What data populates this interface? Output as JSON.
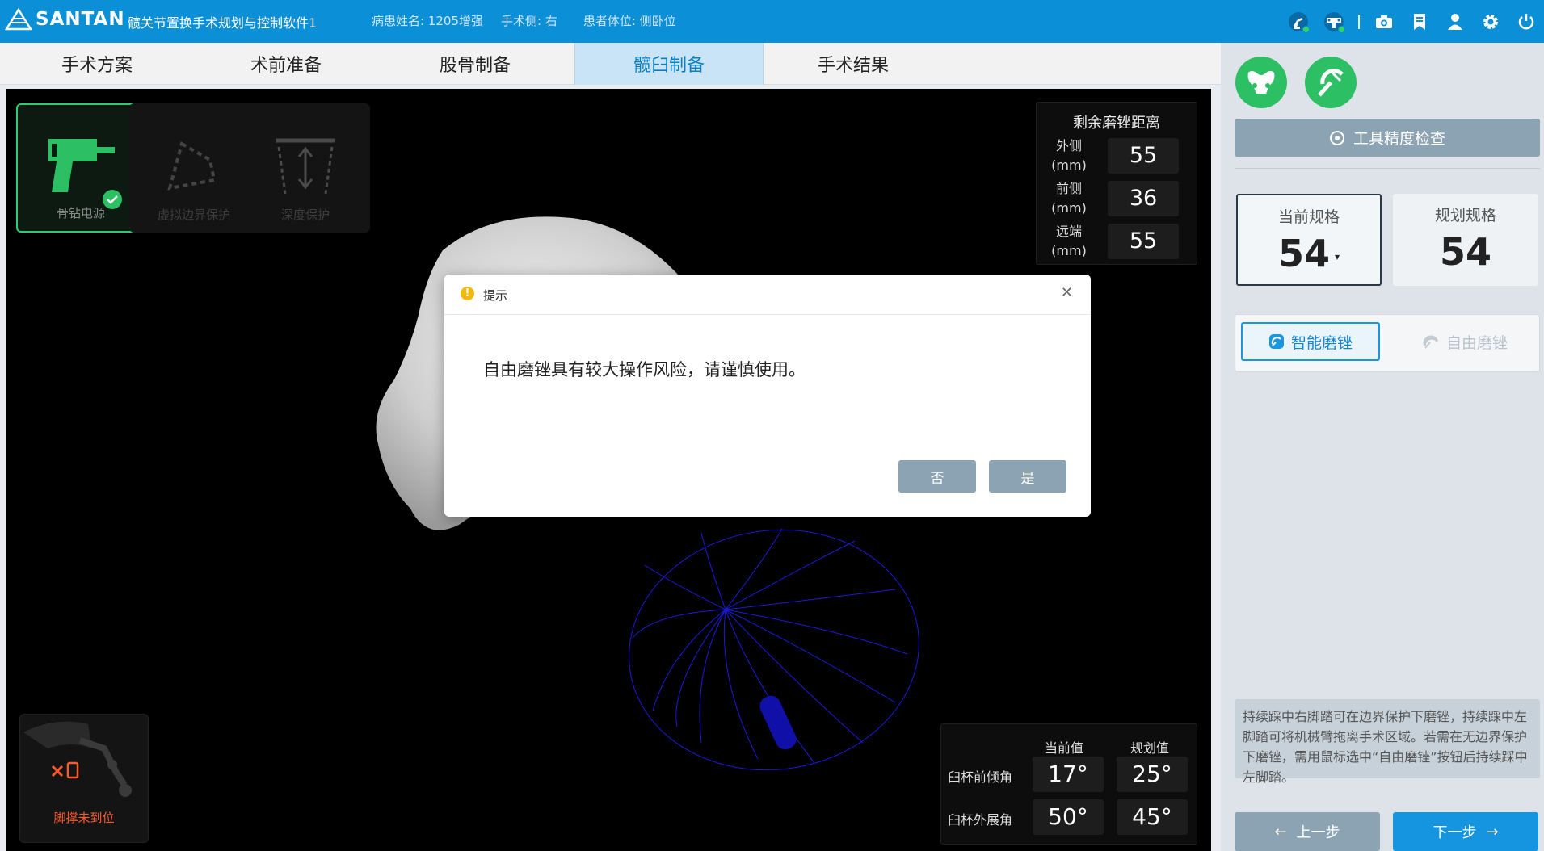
{
  "header": {
    "logo_text": "SANTAN",
    "app_title": "髋关节置换手术规划与控制软件1",
    "patient_name": "病患姓名: 1205增强",
    "surgery_side": "手术侧: 右",
    "patient_position": "患者体位: 侧卧位",
    "icons": [
      "robot-arm-icon",
      "navigation-camera-icon",
      "camera-icon",
      "report-icon",
      "user-icon",
      "settings-icon",
      "power-icon"
    ]
  },
  "tabs": [
    {
      "label": "手术方案",
      "active": false
    },
    {
      "label": "术前准备",
      "active": false
    },
    {
      "label": "股骨制备",
      "active": false
    },
    {
      "label": "髋臼制备",
      "active": true
    },
    {
      "label": "手术结果",
      "active": false
    }
  ],
  "tools": [
    {
      "label": "骨钻电源",
      "state": "active",
      "checked": true
    },
    {
      "label": "虚拟边界保护",
      "state": "disabled"
    },
    {
      "label": "深度保护",
      "state": "disabled"
    }
  ],
  "remaining": {
    "title": "剩余磨锉距离",
    "rows": [
      {
        "label1": "外侧",
        "label2": "(mm)",
        "value": "55"
      },
      {
        "label1": "前侧",
        "label2": "(mm)",
        "value": "36"
      },
      {
        "label1": "远端",
        "label2": "(mm)",
        "value": "55"
      }
    ]
  },
  "footrest": {
    "label": "脚撑未到位"
  },
  "angles": {
    "current_header": "当前值",
    "planned_header": "规划值",
    "rows": [
      {
        "label": "臼杯前倾角",
        "current": "17°",
        "planned": "25°"
      },
      {
        "label": "臼杯外展角",
        "current": "50°",
        "planned": "45°"
      }
    ]
  },
  "right_panel": {
    "precision_button": "工具精度检查",
    "current_spec_title": "当前规格",
    "current_spec_value": "54",
    "planned_spec_title": "规划规格",
    "planned_spec_value": "54",
    "smart_reaming": "智能磨锉",
    "free_reaming": "自由磨锉",
    "hint": "持续踩中右脚踏可在边界保护下磨锉，持续踩中左脚踏可将机械臂拖离手术区域。若需在无边界保护下磨锉，需用鼠标选中“自由磨锉”按钮后持续踩中左脚踏。",
    "prev_button": "上一步",
    "next_button": "下一步"
  },
  "dialog": {
    "title": "提示",
    "message": "自由磨锉具有较大操作风险，请谨慎使用。",
    "no_button": "否",
    "yes_button": "是"
  },
  "colors": {
    "primary": "#0b8fd6",
    "success": "#2dbf63",
    "warning": "#ff5a2a",
    "muted_button": "#8ca3b4"
  }
}
